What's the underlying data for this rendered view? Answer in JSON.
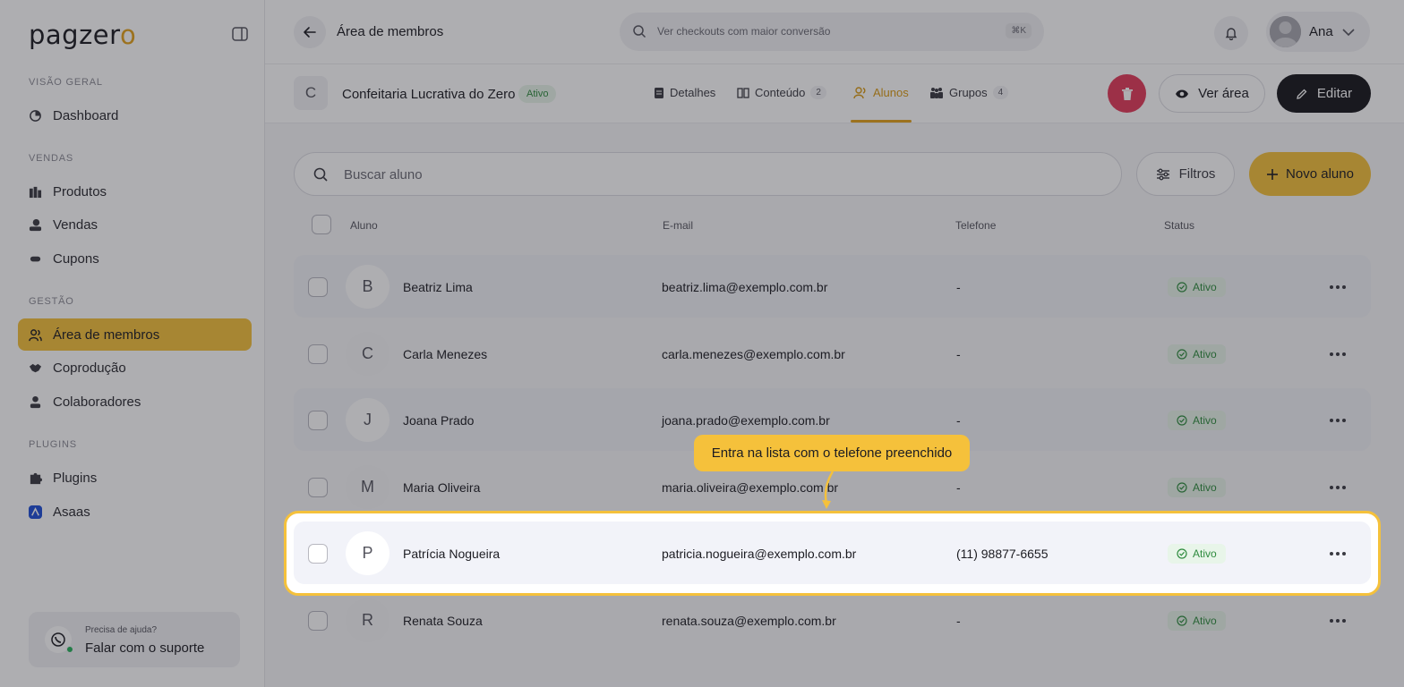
{
  "app": {
    "brand": "pagzer",
    "brand_tail": "o"
  },
  "sidebar": {
    "sections": [
      {
        "title": "VISÃO GERAL"
      },
      {
        "title": "VENDAS"
      },
      {
        "title": "GESTÃO"
      },
      {
        "title": "PLUGINS"
      }
    ],
    "items": [
      {
        "label": "Dashboard",
        "icon": "dashboard-icon"
      },
      {
        "label": "Produtos",
        "icon": "products-icon"
      },
      {
        "label": "Vendas",
        "icon": "sales-icon"
      },
      {
        "label": "Cupons",
        "icon": "coupon-icon"
      },
      {
        "label": "Área de membros",
        "icon": "members-icon",
        "active": true
      },
      {
        "label": "Coprodução",
        "icon": "handshake-icon"
      },
      {
        "label": "Colaboradores",
        "icon": "person-icon"
      },
      {
        "label": "Plugins",
        "icon": "puzzle-icon"
      },
      {
        "label": "Asaas",
        "icon": "asaas-icon"
      }
    ],
    "support": {
      "small": "Precisa de ajuda?",
      "big": "Falar com o suporte"
    }
  },
  "topbar": {
    "title": "Área de membros",
    "search_placeholder": "Ver checkouts com maior conversão",
    "shortcut": "⌘K",
    "user_name": "Ana"
  },
  "product": {
    "initial": "C",
    "title": "Confeitaria Lucrativa do Zero",
    "status": "Ativo",
    "tabs": [
      {
        "label": "Detalhes",
        "count": ""
      },
      {
        "label": "Conteúdo",
        "count": "2"
      },
      {
        "label": "Alunos",
        "count": "",
        "active": true
      },
      {
        "label": "Grupos",
        "count": "4"
      }
    ],
    "view_label": "Ver área",
    "edit_label": "Editar"
  },
  "students": {
    "search_placeholder": "Buscar aluno",
    "filter_label": "Filtros",
    "new_label": "Novo aluno",
    "columns": [
      "Aluno",
      "E-mail",
      "Telefone",
      "Status"
    ],
    "rows": [
      {
        "initial": "B",
        "name": "Beatriz Lima",
        "email": "beatriz.lima@exemplo.com.br",
        "phone": "-",
        "status": "Ativo"
      },
      {
        "initial": "C",
        "name": "Carla Menezes",
        "email": "carla.menezes@exemplo.com.br",
        "phone": "-",
        "status": "Ativo"
      },
      {
        "initial": "J",
        "name": "Joana Prado",
        "email": "joana.prado@exemplo.com.br",
        "phone": "-",
        "status": "Ativo"
      },
      {
        "initial": "M",
        "name": "Maria Oliveira",
        "email": "maria.oliveira@exemplo.com.br",
        "phone": "-",
        "status": "Ativo"
      },
      {
        "initial": "P",
        "name": "Patrícia Nogueira",
        "email": "patricia.nogueira@exemplo.com.br",
        "phone": "(11) 98877-6655",
        "status": "Ativo"
      },
      {
        "initial": "R",
        "name": "Renata Souza",
        "email": "renata.souza@exemplo.com.br",
        "phone": "-",
        "status": "Ativo"
      }
    ]
  },
  "tooltip": {
    "text": "Entra na lista com o telefone preenchido"
  },
  "colors": {
    "accent": "#f5c13b",
    "danger": "#e33b5a",
    "dark": "#16161c",
    "success": "#2e8b3e"
  }
}
